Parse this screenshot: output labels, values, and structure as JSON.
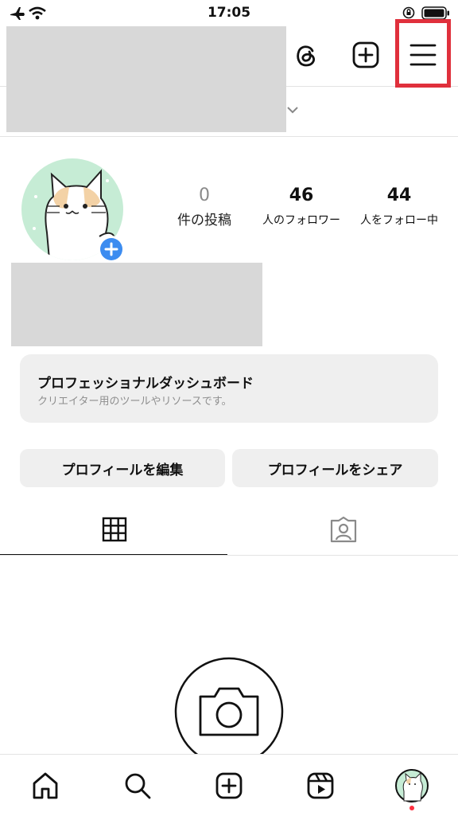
{
  "status_bar": {
    "time": "17:05"
  },
  "header": {
    "icons": [
      "threads-icon",
      "create-post-icon",
      "menu-icon"
    ]
  },
  "profile": {
    "stats": [
      {
        "number": "0",
        "label": "件の投稿"
      },
      {
        "number": "46",
        "label": "人のフォロワー"
      },
      {
        "number": "44",
        "label": "人をフォロー中"
      }
    ]
  },
  "dashboard": {
    "title": "プロフェッショナルダッシュボード",
    "subtitle": "クリエイター用のツールやリソースです。"
  },
  "buttons": {
    "edit_profile": "プロフィールを編集",
    "share_profile": "プロフィールをシェア"
  },
  "tabs": [
    "grid-icon",
    "tagged-icon"
  ],
  "bottom_nav": [
    "home-icon",
    "search-icon",
    "create-icon",
    "reels-icon",
    "profile-avatar"
  ],
  "colors": {
    "highlight": "#e0303c",
    "accent_blue": "#3c8cf0",
    "notification_dot": "#ff3040"
  }
}
